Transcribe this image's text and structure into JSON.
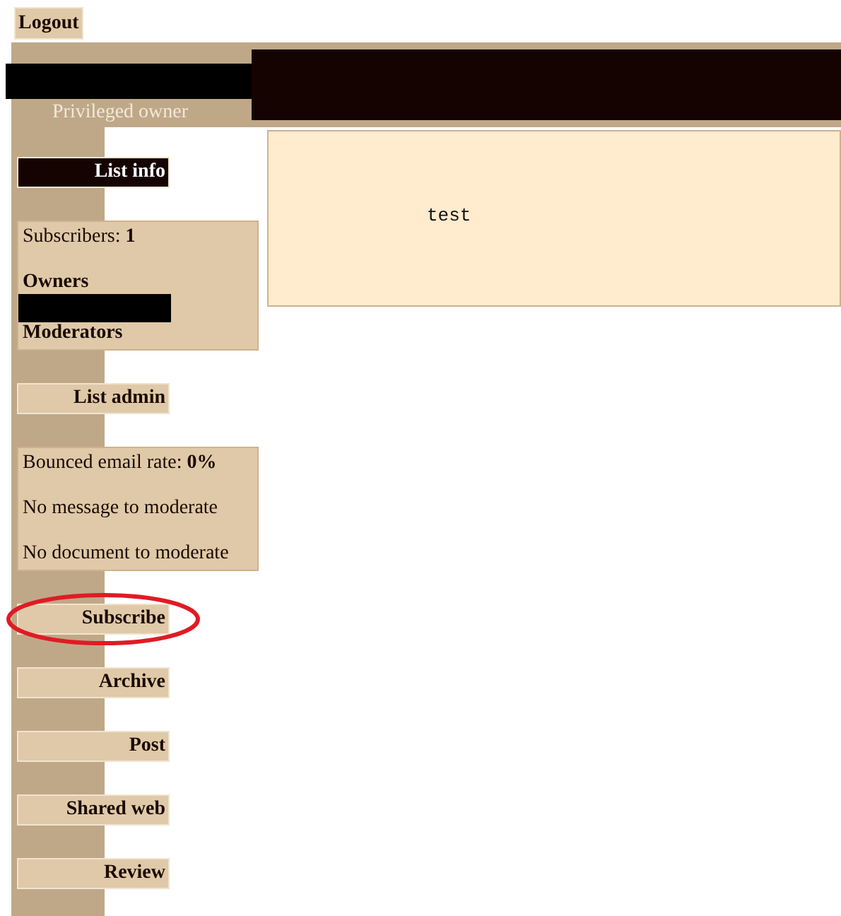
{
  "logout": {
    "label": "Logout"
  },
  "header": {
    "role": "Privileged owner"
  },
  "sidebar": [
    {
      "kind": "nav",
      "label": "List info",
      "selected": true,
      "highlighted": false
    },
    {
      "kind": "info",
      "lines": [
        {
          "kind": "text",
          "text": "Subscribers: **1**"
        },
        {
          "kind": "heading",
          "text": "Owners"
        },
        {
          "kind": "redacted"
        },
        {
          "kind": "heading",
          "text": "Moderators"
        }
      ]
    },
    {
      "kind": "nav",
      "label": "List admin",
      "selected": false,
      "highlighted": false
    },
    {
      "kind": "info",
      "lines": [
        {
          "kind": "text",
          "text": "Bounced email rate: **0%**"
        },
        {
          "kind": "text",
          "text": "No message to moderate"
        },
        {
          "kind": "text",
          "text": "No document to moderate"
        }
      ]
    },
    {
      "kind": "nav",
      "label": "Subscribe",
      "selected": false,
      "highlighted": true
    },
    {
      "kind": "nav",
      "label": "Archive",
      "selected": false,
      "highlighted": false
    },
    {
      "kind": "nav",
      "label": "Post",
      "selected": false,
      "highlighted": false
    },
    {
      "kind": "nav",
      "label": "Shared web",
      "selected": false,
      "highlighted": false
    },
    {
      "kind": "nav",
      "label": "Review",
      "selected": false,
      "highlighted": false
    }
  ],
  "content": {
    "text": "test"
  }
}
